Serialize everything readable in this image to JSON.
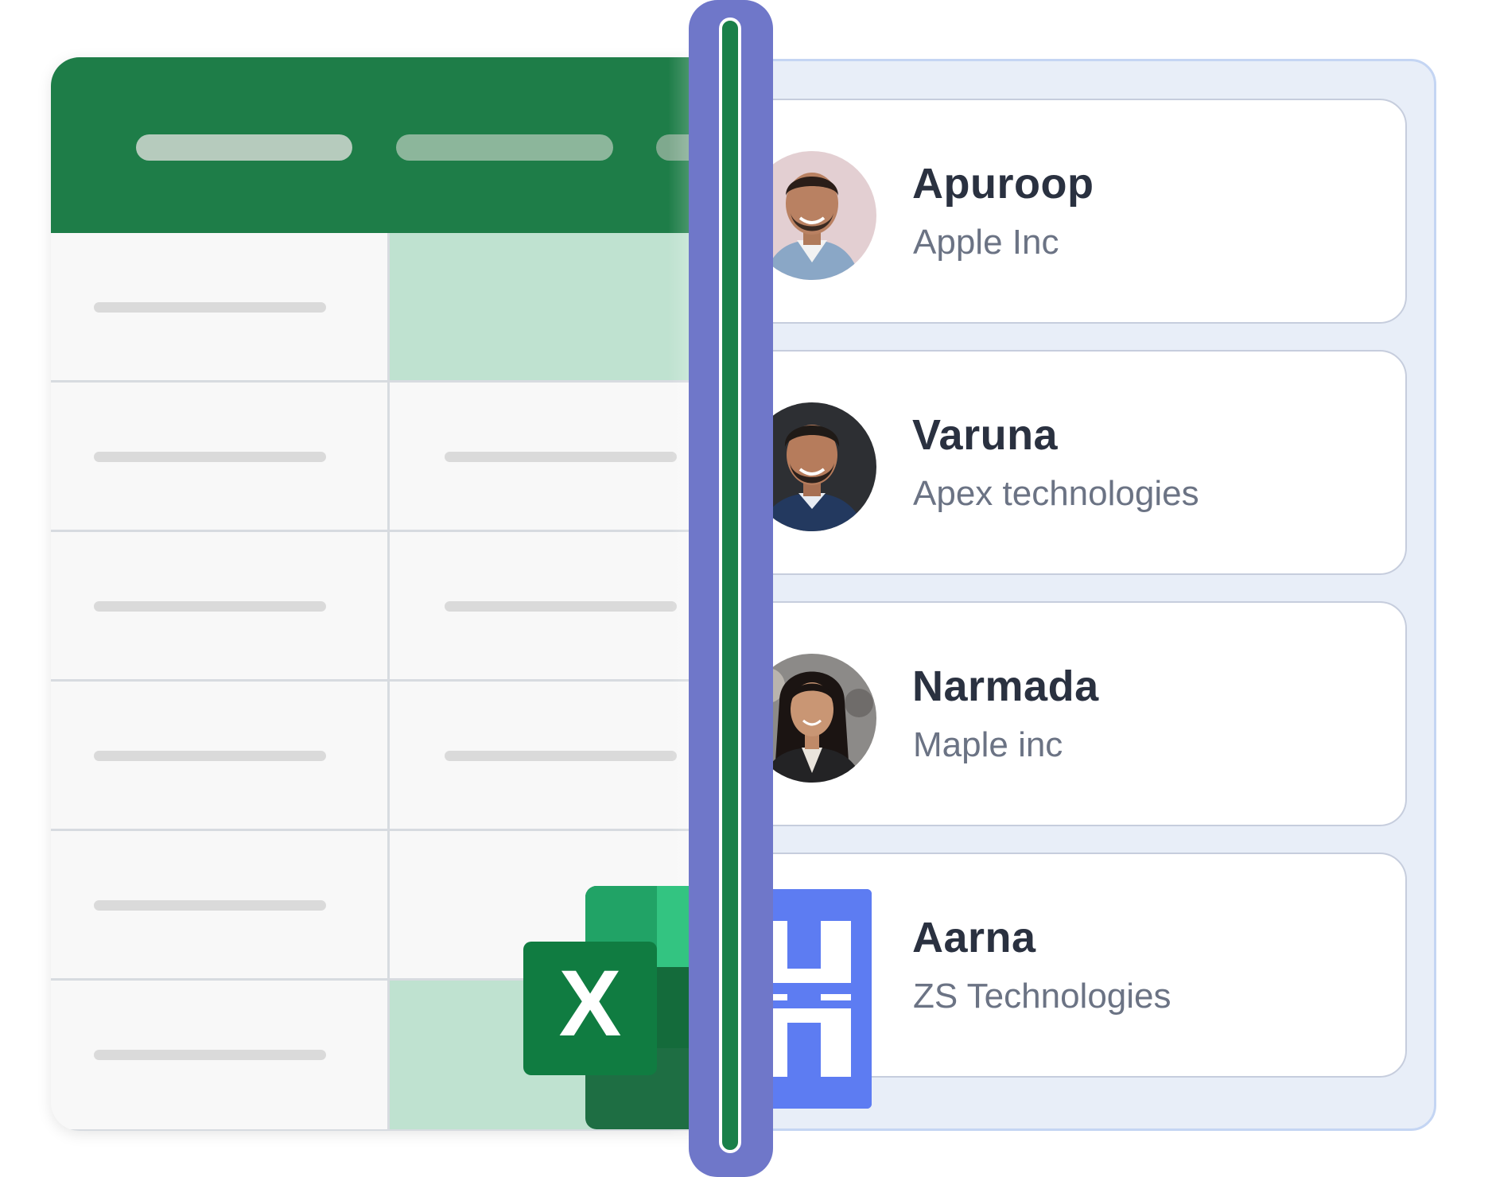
{
  "sheet": {
    "header_color": "#1e7d48",
    "highlight_color": "#bfe2d0"
  },
  "contacts": [
    {
      "name": "Apuroop",
      "company": "Apple Inc",
      "avatar": "person-photo"
    },
    {
      "name": "Varuna",
      "company": "Apex technologies",
      "avatar": "person-photo"
    },
    {
      "name": "Narmada",
      "company": "Maple inc",
      "avatar": "person-photo"
    },
    {
      "name": "Aarna",
      "company": "ZS Technologies",
      "avatar": "brand-logo"
    }
  ],
  "icons": {
    "excel": "excel-icon",
    "brand": "brand-logo-icon"
  },
  "colors": {
    "excel_green": "#1e7d48",
    "panel_bg": "#e8eef8",
    "brand_blue": "#5d7cf2",
    "divider_glow": "#6f77c9"
  }
}
